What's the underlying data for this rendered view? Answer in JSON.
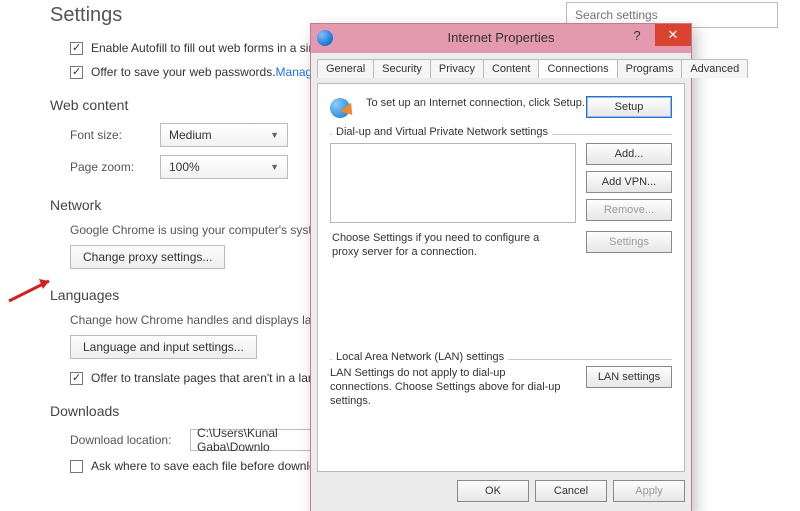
{
  "chrome": {
    "title": "Settings",
    "search_placeholder": "Search settings",
    "autofill_label": "Enable Autofill to fill out web forms in a singl",
    "passwords_label": "Offer to save your web passwords. ",
    "passwords_link": "Manage p",
    "webcontent_h": "Web content",
    "fontsize_label": "Font size:",
    "fontsize_value": "Medium",
    "pagezoom_label": "Page zoom:",
    "pagezoom_value": "100%",
    "network_h": "Network",
    "network_desc": "Google Chrome is using your computer's system",
    "proxy_btn": "Change proxy settings...",
    "languages_h": "Languages",
    "languages_desc": "Change how Chrome handles and displays langua",
    "lang_btn": "Language and input settings...",
    "translate_label": "Offer to translate pages that aren't in a langu",
    "downloads_h": "Downloads",
    "dl_label": "Download location:",
    "dl_value": "C:\\Users\\Kunal Gaba\\Downlo",
    "dl_ask_label": "Ask where to save each file before downloadi"
  },
  "dialog": {
    "title": "Internet Properties",
    "tabs": [
      "General",
      "Security",
      "Privacy",
      "Content",
      "Connections",
      "Programs",
      "Advanced"
    ],
    "setup_text": "To set up an Internet connection, click Setup.",
    "setup_btn": "Setup",
    "dial_legend": "Dial-up and Virtual Private Network settings",
    "add_btn": "Add...",
    "addvpn_btn": "Add VPN...",
    "remove_btn": "Remove...",
    "settings_btn": "Settings",
    "dial_note": "Choose Settings if you need to configure a proxy server for a connection.",
    "lan_legend": "Local Area Network (LAN) settings",
    "lan_text": "LAN Settings do not apply to dial-up connections. Choose Settings above for dial-up settings.",
    "lan_btn": "LAN settings",
    "ok": "OK",
    "cancel": "Cancel",
    "apply": "Apply"
  }
}
